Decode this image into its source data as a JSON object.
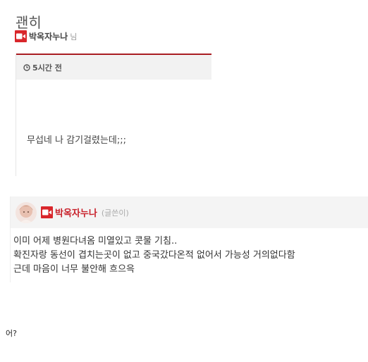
{
  "post": {
    "title": "괜히",
    "author_name": "박옥자누나",
    "author_suffix": "님",
    "time": "5시간 전",
    "body": "무섭네 나 감기걸렸는데;;;"
  },
  "comment": {
    "author_name": "박옥자누나",
    "author_tag": "(글쓴이)",
    "lines": [
      "이미 어제 병원다녀옴 미열있고 콧물 기침..",
      "확진자랑 동선이 겹치는곳이 없고 중국갔다온적 없어서 가능성 거의없다함",
      "근데 마음이 너무 불안해 흐으윽"
    ]
  },
  "footer": {
    "text": "어?"
  },
  "colors": {
    "accent": "#d9262b",
    "divider": "#a91d22",
    "meta_bg": "#f2f2f2"
  }
}
